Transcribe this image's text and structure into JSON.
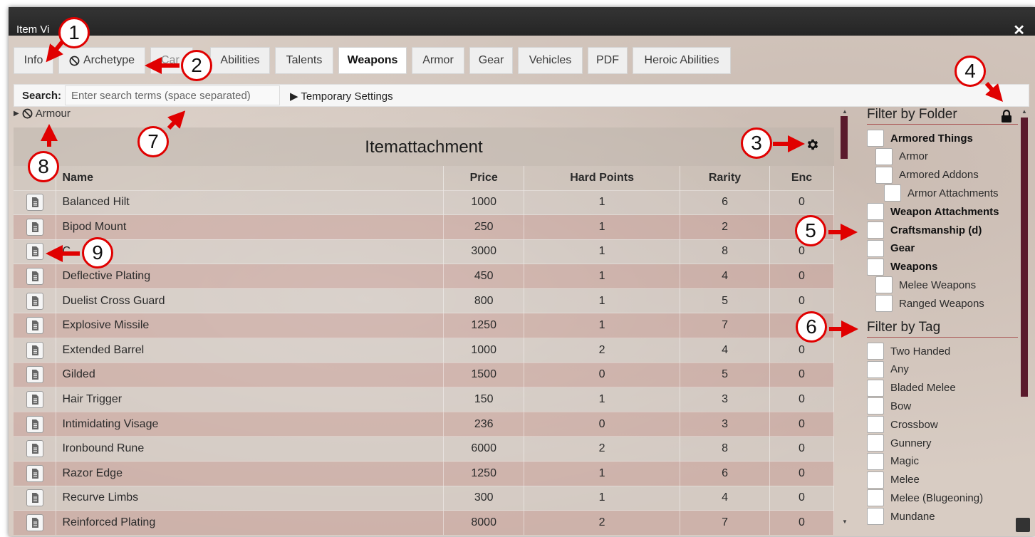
{
  "window": {
    "title": "Item Vi",
    "close_icon": "close-icon"
  },
  "tabs": [
    {
      "label": "Info"
    },
    {
      "label": "Archetype",
      "icon": "ban-icon"
    },
    {
      "label": "Car"
    },
    {
      "label": "Abilities"
    },
    {
      "label": "Talents"
    },
    {
      "label": "Weapons",
      "active": true
    },
    {
      "label": "Armor"
    },
    {
      "label": "Gear"
    },
    {
      "label": "Vehicles"
    },
    {
      "label": "PDF"
    },
    {
      "label": "Heroic Abilities"
    }
  ],
  "search": {
    "label": "Search:",
    "placeholder": "Enter search terms (space separated)",
    "value": "",
    "temp_settings": "▶ Temporary Settings"
  },
  "breadcrumb": {
    "caret": "▶",
    "icon": "ban-icon",
    "label": "Armour"
  },
  "section": {
    "title": "Itemattachment",
    "settings_icon": "gear-icon"
  },
  "table": {
    "headers": [
      "",
      "Name",
      "Price",
      "Hard Points",
      "Rarity",
      "Enc"
    ],
    "rows": [
      {
        "name": "Balanced Hilt",
        "price": "1000",
        "hard_points": "1",
        "rarity": "6",
        "enc": "0"
      },
      {
        "name": "Bipod Mount",
        "price": "250",
        "hard_points": "1",
        "rarity": "2",
        "enc": "1"
      },
      {
        "name": "C",
        "price": "3000",
        "hard_points": "1",
        "rarity": "8",
        "enc": "0"
      },
      {
        "name": "Deflective Plating",
        "price": "450",
        "hard_points": "1",
        "rarity": "4",
        "enc": "0"
      },
      {
        "name": "Duelist Cross Guard",
        "price": "800",
        "hard_points": "1",
        "rarity": "5",
        "enc": "0"
      },
      {
        "name": "Explosive Missile",
        "price": "1250",
        "hard_points": "1",
        "rarity": "7",
        "enc": ""
      },
      {
        "name": "Extended Barrel",
        "price": "1000",
        "hard_points": "2",
        "rarity": "4",
        "enc": "0"
      },
      {
        "name": "Gilded",
        "price": "1500",
        "hard_points": "0",
        "rarity": "5",
        "enc": "0"
      },
      {
        "name": "Hair Trigger",
        "price": "150",
        "hard_points": "1",
        "rarity": "3",
        "enc": "0"
      },
      {
        "name": "Intimidating Visage",
        "price": "236",
        "hard_points": "0",
        "rarity": "3",
        "enc": "0"
      },
      {
        "name": "Ironbound Rune",
        "price": "6000",
        "hard_points": "2",
        "rarity": "8",
        "enc": "0"
      },
      {
        "name": "Razor Edge",
        "price": "1250",
        "hard_points": "1",
        "rarity": "6",
        "enc": "0"
      },
      {
        "name": "Recurve Limbs",
        "price": "300",
        "hard_points": "1",
        "rarity": "4",
        "enc": "0"
      },
      {
        "name": "Reinforced Plating",
        "price": "8000",
        "hard_points": "2",
        "rarity": "7",
        "enc": "0"
      }
    ]
  },
  "filter_folder": {
    "heading": "Filter by Folder",
    "lock_icon": "lock-icon",
    "items": [
      {
        "label": "Armored Things",
        "bold": true
      },
      {
        "label": "Armor",
        "bold": false
      },
      {
        "label": "Armored Addons",
        "bold": false
      },
      {
        "label": "Armor Attachments",
        "bold": false
      },
      {
        "label": "Weapon Attachments",
        "bold": true
      },
      {
        "label": "Craftsmanship (d)",
        "bold": true
      },
      {
        "label": "Gear",
        "bold": true
      },
      {
        "label": "Weapons",
        "bold": true
      },
      {
        "label": "Melee Weapons",
        "bold": false
      },
      {
        "label": "Ranged Weapons",
        "bold": false
      }
    ]
  },
  "filter_tag": {
    "heading": "Filter by Tag",
    "items": [
      {
        "label": "Two Handed"
      },
      {
        "label": "Any"
      },
      {
        "label": "Bladed Melee"
      },
      {
        "label": "Bow"
      },
      {
        "label": "Crossbow"
      },
      {
        "label": "Gunnery"
      },
      {
        "label": "Magic"
      },
      {
        "label": "Melee"
      },
      {
        "label": "Melee (Blugeoning)"
      },
      {
        "label": "Mundane"
      }
    ]
  },
  "callouts": [
    "1",
    "2",
    "3",
    "4",
    "5",
    "6",
    "7",
    "8",
    "9"
  ],
  "colors": {
    "accent": "#5a1a2c",
    "callout_red": "#e00000",
    "row_alt": "#c49c96"
  }
}
